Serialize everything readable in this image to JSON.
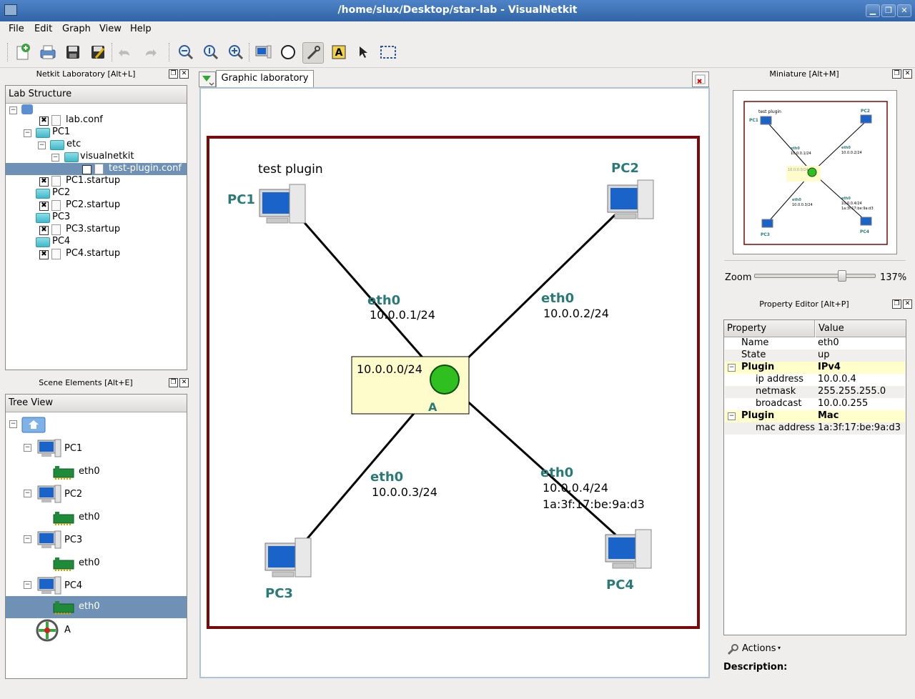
{
  "window": {
    "title": "/home/slux/Desktop/star-lab - VisualNetkit",
    "minimize": "▁",
    "maximize": "❐",
    "close": "✕"
  },
  "menu": [
    "File",
    "Edit",
    "Graph",
    "View",
    "Help"
  ],
  "docks": {
    "netkit_lab": {
      "title": "Netkit Laboratory [Alt+L]",
      "header": "Lab Structure",
      "items": [
        {
          "label": "lab.conf",
          "kind": "file",
          "checked": "✖"
        },
        {
          "label": "PC1",
          "kind": "folder"
        },
        {
          "label": "etc",
          "kind": "folder"
        },
        {
          "label": "visualnetkit",
          "kind": "folder"
        },
        {
          "label": "test-plugin.conf",
          "kind": "file",
          "checked": "✖",
          "selected": true
        },
        {
          "label": "PC1.startup",
          "kind": "file",
          "checked": "✖"
        },
        {
          "label": "PC2",
          "kind": "folder"
        },
        {
          "label": "PC2.startup",
          "kind": "file",
          "checked": "✖"
        },
        {
          "label": "PC3",
          "kind": "folder"
        },
        {
          "label": "PC3.startup",
          "kind": "file",
          "checked": "✖"
        },
        {
          "label": "PC4",
          "kind": "folder"
        },
        {
          "label": "PC4.startup",
          "kind": "file",
          "checked": "✖"
        }
      ]
    },
    "scene_elements": {
      "title": "Scene Elements [Alt+E]",
      "header": "Tree View",
      "items": [
        {
          "label": "PC1"
        },
        {
          "label": "eth0"
        },
        {
          "label": "PC2"
        },
        {
          "label": "eth0"
        },
        {
          "label": "PC3"
        },
        {
          "label": "eth0"
        },
        {
          "label": "PC4"
        },
        {
          "label": "eth0",
          "selected": true
        },
        {
          "label": "A"
        }
      ]
    },
    "miniature": {
      "title": "Miniature [Alt+M]",
      "labels": {
        "plugin": "test plugin",
        "pc1": "PC1",
        "pc2": "PC2",
        "pc3": "PC3",
        "pc4": "PC4",
        "eth1": "eth0",
        "ip1": "10.0.0.1/24",
        "eth2": "eth0",
        "ip2": "10.0.0.2/24",
        "net": "10.0.0.0/24",
        "eth3": "eth0",
        "ip3": "10.0.0.3/24",
        "eth4": "eth0",
        "ip4": "10.0.0.4/24",
        "mac4": "1a:3f:17:be:9a:d3"
      }
    },
    "zoom": {
      "label": "Zoom",
      "value": "137%",
      "level_percent": 72
    },
    "property_editor": {
      "title": "Property Editor [Alt+P]",
      "col_property": "Property",
      "col_value": "Value",
      "rows": [
        {
          "property": "Name",
          "value": "eth0"
        },
        {
          "property": "State",
          "value": "up"
        },
        {
          "property": "Plugin",
          "value": "IPv4"
        },
        {
          "property": "ip address",
          "value": "10.0.0.4"
        },
        {
          "property": "netmask",
          "value": "255.255.255.0"
        },
        {
          "property": "broadcast",
          "value": "10.0.0.255"
        },
        {
          "property": "Plugin",
          "value": "Mac"
        },
        {
          "property": "mac address",
          "value": "1a:3f:17:be:9a:d3"
        }
      ],
      "actions": "Actions",
      "description": "Description:"
    }
  },
  "graphic_lab": {
    "tab": "Graphic laboratory",
    "plugin_label": "test plugin",
    "hosts": [
      "PC1",
      "PC2",
      "PC3",
      "PC4"
    ],
    "collision_domain": {
      "name": "A",
      "subnet": "10.0.0.0/24"
    },
    "links": [
      {
        "iface": "eth0",
        "ip": "10.0.0.1/24"
      },
      {
        "iface": "eth0",
        "ip": "10.0.0.2/24"
      },
      {
        "iface": "eth0",
        "ip": "10.0.0.3/24"
      },
      {
        "iface": "eth0",
        "ip": "10.0.0.4/24",
        "mac": "1a:3f:17:be:9a:d3"
      }
    ]
  },
  "colors": {
    "accent": "#2f63a6",
    "selection": "#6f91b6",
    "lab_border": "#7a0a0a",
    "node_label": "#2b7a78",
    "domain_fill": "#fffccc",
    "node_green": "#2fbf1f"
  }
}
